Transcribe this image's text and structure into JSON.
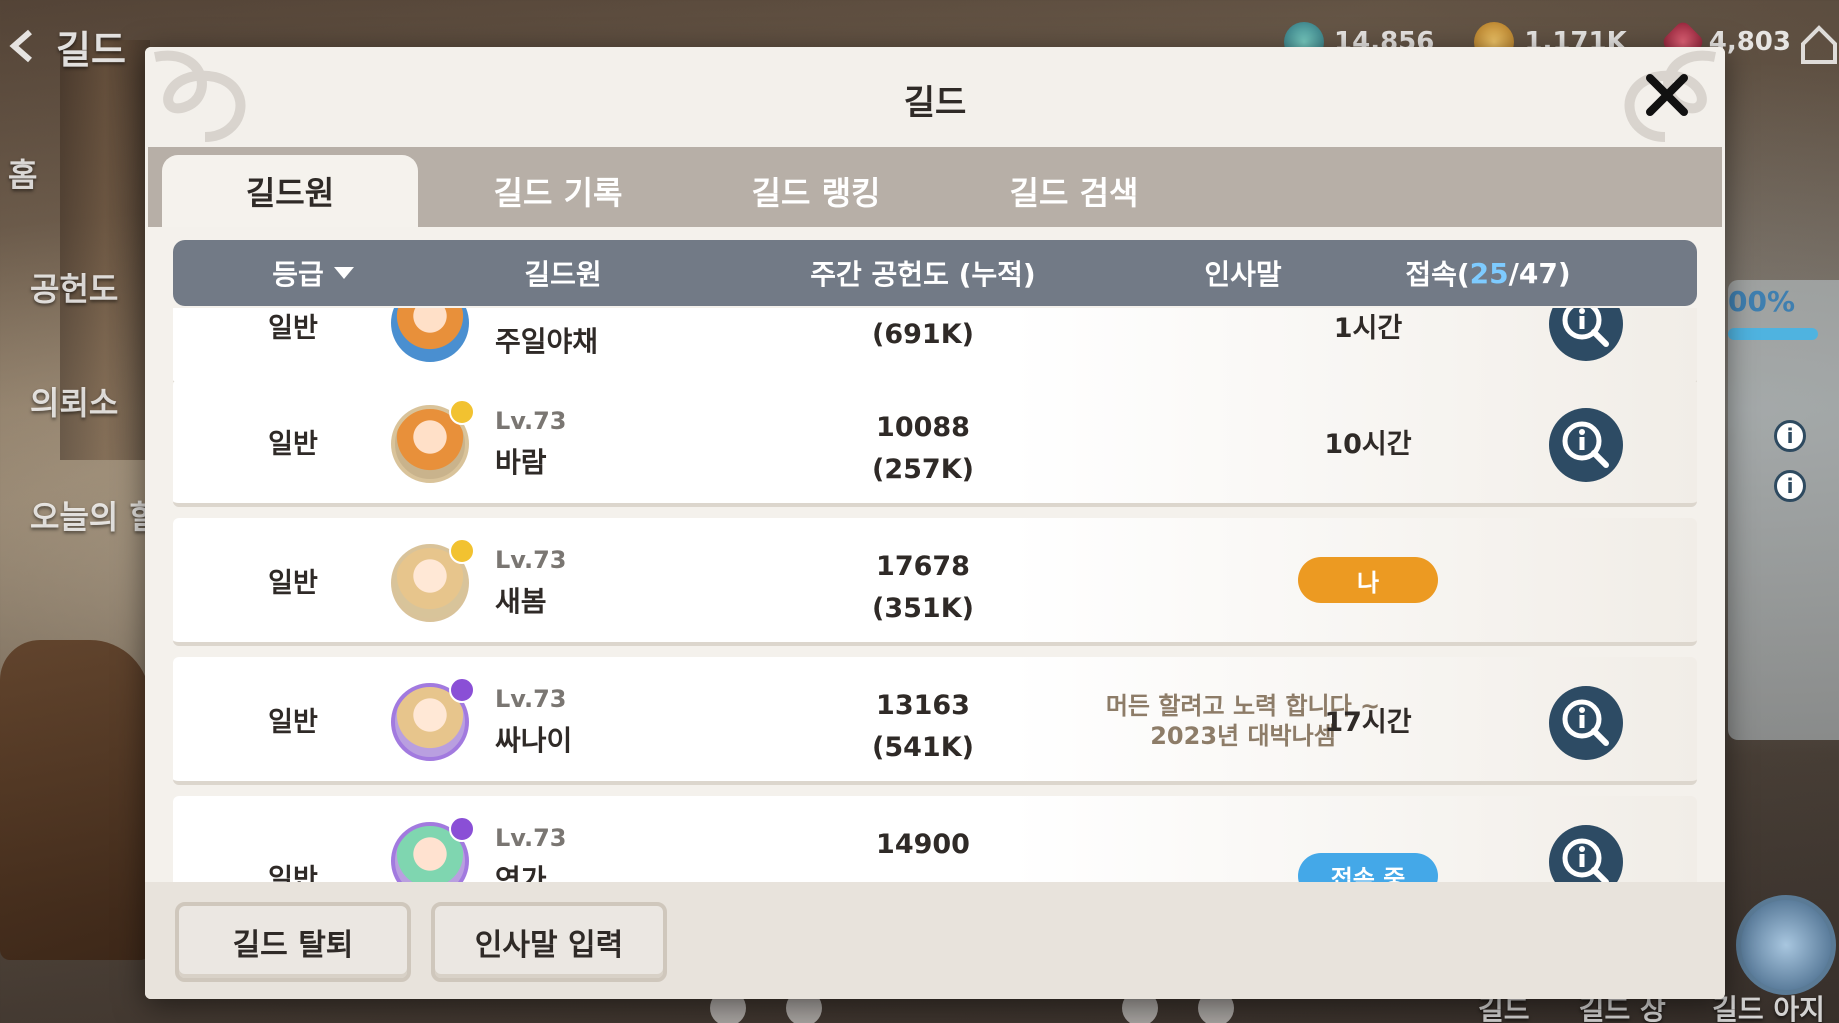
{
  "background": {
    "nav_title": "길드",
    "left_menu": [
      "홈",
      "공헌도",
      "의뢰소",
      "오늘의 할"
    ],
    "currencies": [
      {
        "icon": "gem-icon",
        "value": "14,856"
      },
      {
        "icon": "gold-coin-icon",
        "value": "1,171K"
      },
      {
        "icon": "ruby-icon",
        "value": "4,803"
      }
    ],
    "right_percent": "00%",
    "bottom_nav": [
      "길드원",
      "길드 상점",
      "길드 아지트"
    ]
  },
  "modal": {
    "title": "길드",
    "tabs": [
      {
        "label": "길드원",
        "active": true
      },
      {
        "label": "길드 기록",
        "active": false
      },
      {
        "label": "길드 랭킹",
        "active": false
      },
      {
        "label": "길드 검색",
        "active": false
      }
    ],
    "columns": {
      "grade": "등급",
      "member": "길드원",
      "contribution": "주간 공헌도 (누적)",
      "greeting": "인사말",
      "access_prefix": "접속(",
      "access_online": "25",
      "access_total": "/47)"
    },
    "rows": [
      {
        "grade": "일반",
        "level": "",
        "name": "주일야채",
        "weekly": "",
        "total": "(691K)",
        "greeting_l1": "",
        "greeting_l2": "",
        "status": "1시간",
        "status_type": "text",
        "avatar": "blue"
      },
      {
        "grade": "일반",
        "level": "Lv.73",
        "name": "바람",
        "weekly": "10088",
        "total": "(257K)",
        "greeting_l1": "",
        "greeting_l2": "",
        "status": "10시간",
        "status_type": "text",
        "avatar": "orange"
      },
      {
        "grade": "일반",
        "level": "Lv.73",
        "name": "새봄",
        "weekly": "17678",
        "total": "(351K)",
        "greeting_l1": "",
        "greeting_l2": "",
        "status": "나",
        "status_type": "me",
        "avatar": "blonde"
      },
      {
        "grade": "일반",
        "level": "Lv.73",
        "name": "싸나이",
        "weekly": "13163",
        "total": "(541K)",
        "greeting_l1": "머든 할려고 노력 합니다 ~",
        "greeting_l2": "2023년 대박나셈",
        "status": "17시간",
        "status_type": "text",
        "avatar": "purple"
      },
      {
        "grade": "일반",
        "level": "Lv.73",
        "name": "연가",
        "weekly": "14900",
        "total": "",
        "greeting_l1": "",
        "greeting_l2": "",
        "status": "접속 중",
        "status_type": "online",
        "avatar": "green"
      }
    ],
    "footer": {
      "leave_label": "길드 탈퇴",
      "greeting_label": "인사말 입력"
    }
  }
}
